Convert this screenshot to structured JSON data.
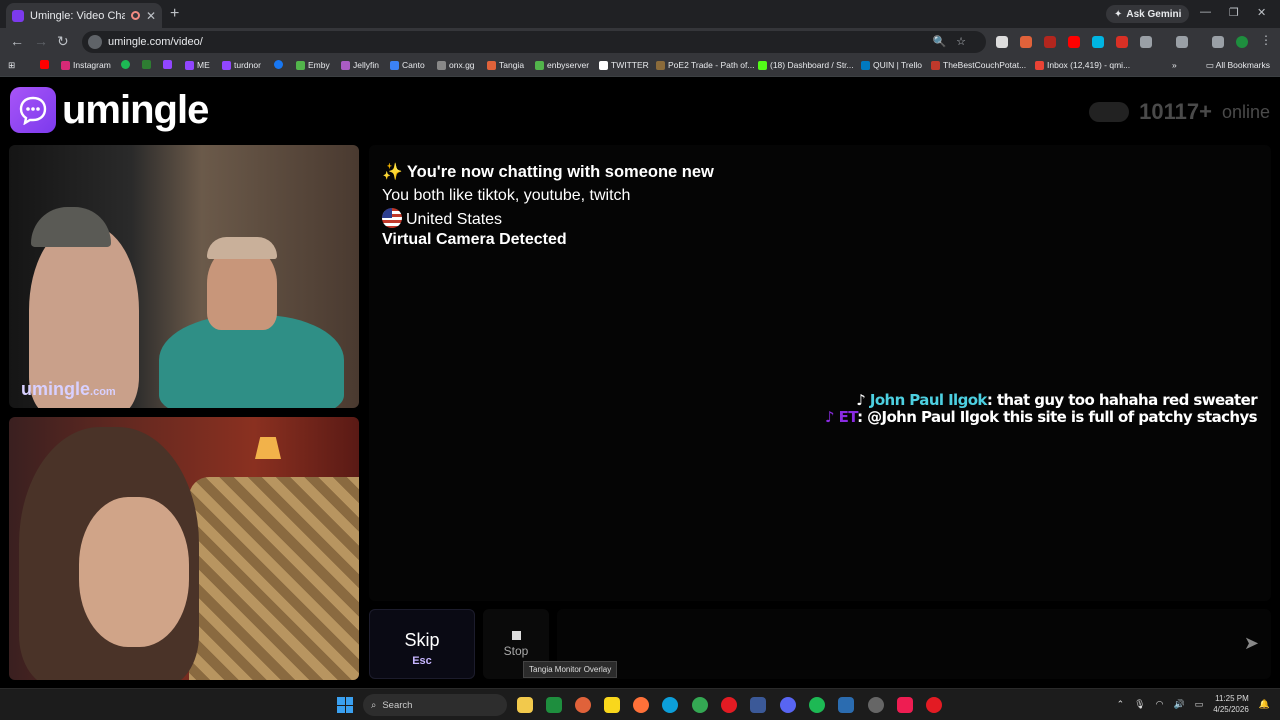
{
  "browser": {
    "tab_title": "Umingle: Video Chat with S",
    "close_glyph": "✕",
    "new_tab_glyph": "+",
    "ask_gemini": "Ask Gemini",
    "url": "umingle.com/video/",
    "bookmarks": [
      "Instagram",
      "ME",
      "turdnor",
      "Emby",
      "Jellyfin",
      "Canto",
      "onx.gg",
      "Tangia",
      "enbyserver",
      "TWITTER",
      "PoE2 Trade - Path of...",
      "(18) Dashboard / Str...",
      "QUIN | Trello",
      "TheBestCouchPotat...",
      "Inbox (12,419) - qmi..."
    ],
    "all_bookmarks": "All Bookmarks",
    "colors": {
      "tabstrip": "#202124",
      "toolbar": "#35363a"
    }
  },
  "site": {
    "logo_text": "umingle",
    "online_count": "10117+",
    "online_label": "online",
    "watermark": "umingle",
    "watermark_suffix": ".com",
    "brand_color": "#7c3aed"
  },
  "chat": {
    "header": "✨ You're now chatting with someone new",
    "interests": "You both like tiktok, youtube, twitch",
    "country": "United States",
    "warning": "Virtual Camera Detected",
    "overlay_messages": [
      {
        "user": "John Paul Ilgok",
        "text": ": that guy too hahaha red sweater"
      },
      {
        "user": "ET",
        "text": ": @John Paul Ilgok this site is full of patchy stachys"
      }
    ]
  },
  "controls": {
    "skip_label": "Skip",
    "skip_key": "Esc",
    "stop_label": "Stop",
    "message_placeholder": "",
    "send_icon": "send-icon",
    "tooltip": "Tangia Monitor Overlay"
  },
  "taskbar": {
    "search_label": "Search",
    "time": "11:25 PM",
    "date": "4/25/2026"
  }
}
